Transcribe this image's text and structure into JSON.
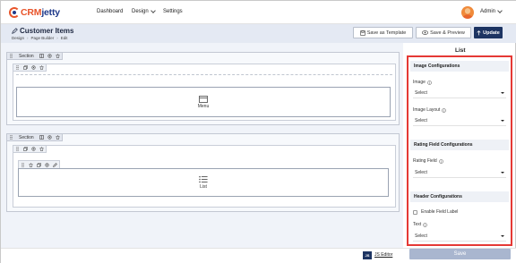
{
  "nav": {
    "logo_crm": "CRM",
    "logo_jetty": "jetty",
    "items": [
      "Dashboard",
      "Design",
      "Settings"
    ],
    "user": "Admin"
  },
  "header": {
    "title": "Customer Items",
    "breadcrumb": [
      "Design",
      "Page Builder",
      "Edit"
    ],
    "buttons": {
      "save_template": "Save as Template",
      "save_preview": "Save & Preview",
      "update": "Update"
    }
  },
  "canvas": {
    "section_label": "Section",
    "widgets": [
      "Menu",
      "List"
    ]
  },
  "panel": {
    "title": "List",
    "groups": {
      "image": {
        "title": "Image Configurations",
        "image_label": "Image",
        "image_value": "Select",
        "layout_label": "Image Layout",
        "layout_value": "Select"
      },
      "rating": {
        "title": "Rating Field Configurations",
        "field_label": "Rating Field",
        "field_value": "Select"
      },
      "header": {
        "title": "Header Configurations",
        "enable_label": "Enable Field Label",
        "text_label": "Text",
        "text_value": "Select"
      }
    }
  },
  "footer": {
    "js_editor": "JS Editor",
    "js_badge": "JS",
    "save": "Save"
  },
  "colors": {
    "brand_orange": "#e8542a",
    "brand_navy": "#1d3462",
    "highlight_red": "#e53935"
  }
}
